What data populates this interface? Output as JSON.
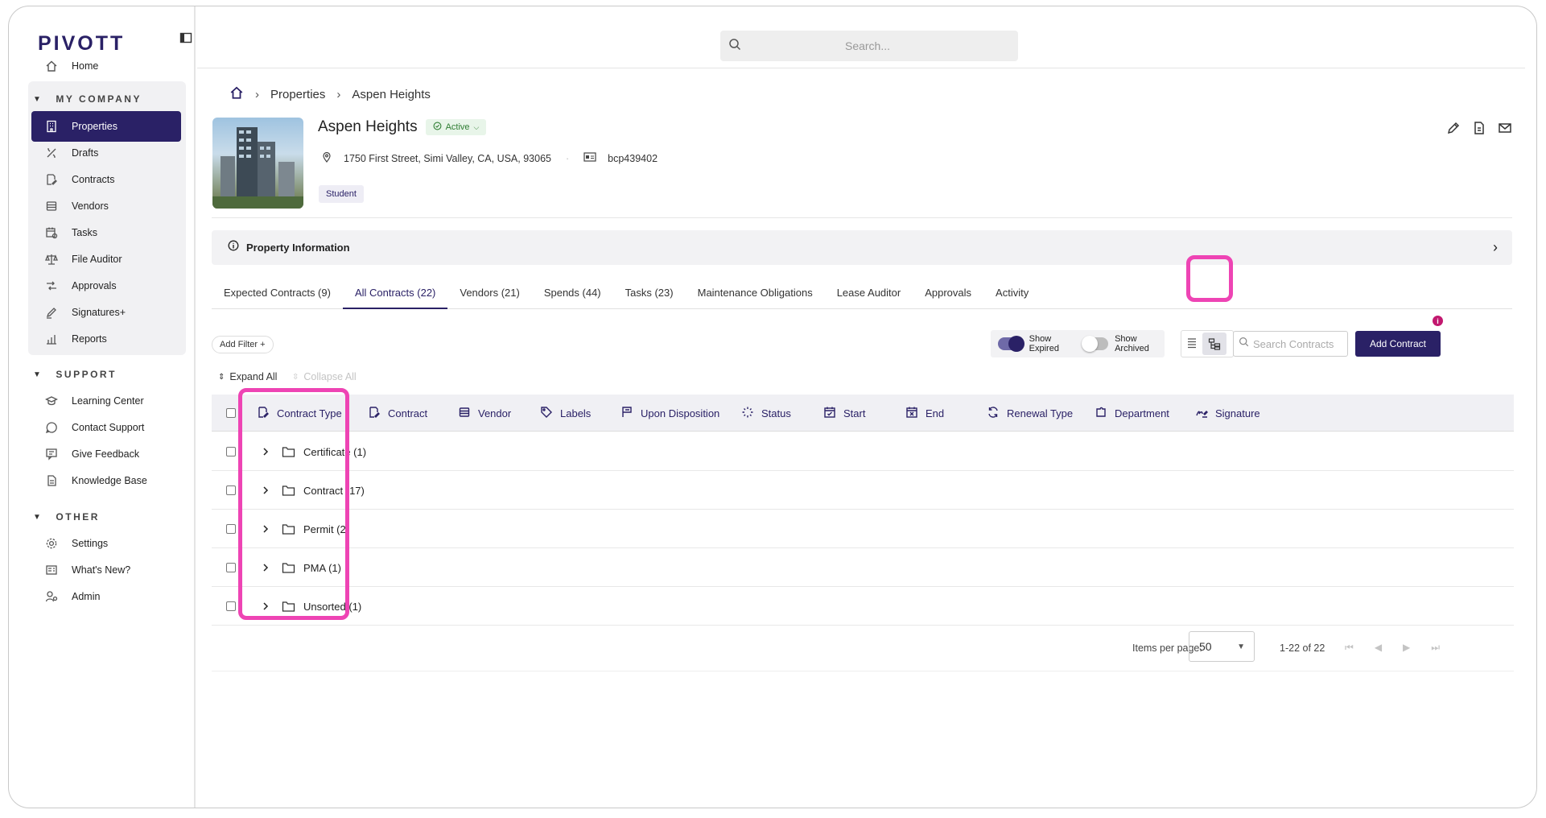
{
  "app": {
    "logo": "PIVOTT",
    "home": "Home"
  },
  "sidebar": {
    "sections": {
      "my_company": "MY COMPANY",
      "support": "SUPPORT",
      "other": "OTHER"
    },
    "my_company_items": [
      {
        "label": "Properties",
        "icon": "building-icon"
      },
      {
        "label": "Drafts",
        "icon": "drafts-icon"
      },
      {
        "label": "Contracts",
        "icon": "contract-edit-icon"
      },
      {
        "label": "Vendors",
        "icon": "vendor-icon"
      },
      {
        "label": "Tasks",
        "icon": "calendar-task-icon"
      },
      {
        "label": "File Auditor",
        "icon": "scale-icon"
      },
      {
        "label": "Approvals",
        "icon": "approvals-icon"
      },
      {
        "label": "Signatures+",
        "icon": "signature-pen-icon"
      },
      {
        "label": "Reports",
        "icon": "reports-icon"
      }
    ],
    "support_items": [
      {
        "label": "Learning Center",
        "icon": "graduation-cap-icon"
      },
      {
        "label": "Contact Support",
        "icon": "chat-icon"
      },
      {
        "label": "Give Feedback",
        "icon": "feedback-icon"
      },
      {
        "label": "Knowledge Base",
        "icon": "document-icon"
      }
    ],
    "other_items": [
      {
        "label": "Settings",
        "icon": "gear-icon"
      },
      {
        "label": "What's New?",
        "icon": "news-icon"
      },
      {
        "label": "Admin",
        "icon": "admin-user-icon"
      }
    ]
  },
  "topbar": {
    "search_placeholder": "Search..."
  },
  "breadcrumb": {
    "items": [
      "Properties",
      "Aspen Heights"
    ]
  },
  "property": {
    "name": "Aspen Heights",
    "status": "Active",
    "address": "1750 First Street, Simi Valley, CA, USA, 93065",
    "code": "bcp439402",
    "tag": "Student"
  },
  "info_panel": {
    "title": "Property Information"
  },
  "tabs": [
    "Expected Contracts (9)",
    "All Contracts (22)",
    "Vendors (21)",
    "Spends (44)",
    "Tasks (23)",
    "Maintenance Obligations",
    "Lease Auditor",
    "Approvals",
    "Activity"
  ],
  "toolbar": {
    "add_filter": "Add Filter +",
    "show_expired": "Show Expired",
    "show_archived": "Show Archived",
    "search_contracts_placeholder": "Search Contracts",
    "add_contract": "Add Contract",
    "expand_all": "Expand All",
    "collapse_all": "Collapse All"
  },
  "table": {
    "columns": [
      "Contract Type",
      "Contract",
      "Vendor",
      "Labels",
      "Upon Disposition",
      "Status",
      "Start",
      "End",
      "Renewal Type",
      "Department",
      "Signature"
    ],
    "groups": [
      "Certificate (1)",
      "Contract (17)",
      "Permit (2)",
      "PMA (1)",
      "Unsorted (1)"
    ]
  },
  "pagination": {
    "items_per_page_label": "Items per page:",
    "items_per_page": "50",
    "range": "1-22 of 22"
  },
  "colors": {
    "brand": "#2a2166",
    "highlight": "#ee44b4",
    "active_green": "#2e7d32"
  }
}
